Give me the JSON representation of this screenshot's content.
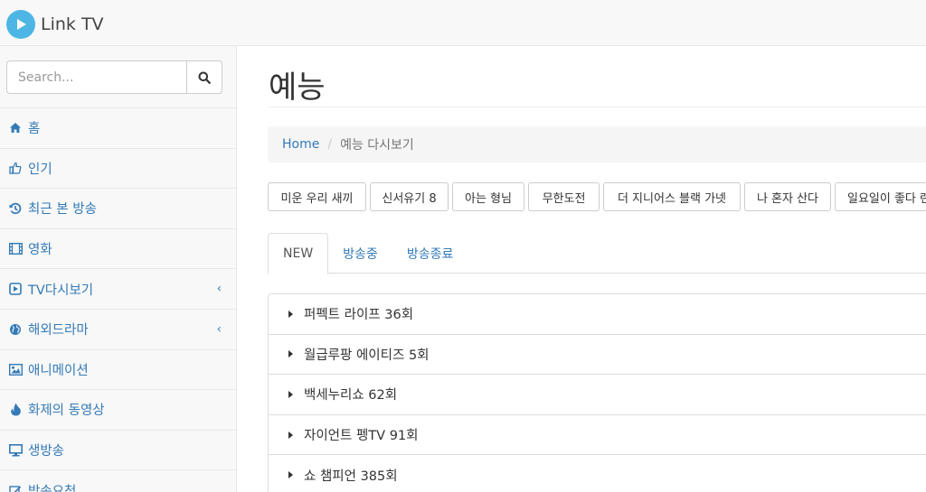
{
  "brand": {
    "title": "Link TV",
    "logo_icon": "play-circle-icon",
    "logo_color": "#4db6e4"
  },
  "search": {
    "placeholder": "Search...",
    "value": ""
  },
  "sidebar": {
    "items": [
      {
        "label": "홈",
        "icon": "home-icon"
      },
      {
        "label": "인기",
        "icon": "thumbs-up-icon"
      },
      {
        "label": "최근 본 방송",
        "icon": "history-icon"
      },
      {
        "label": "영화",
        "icon": "film-icon"
      },
      {
        "label": "TV다시보기",
        "icon": "play-square-icon",
        "chevron": "‹"
      },
      {
        "label": "해외드라마",
        "icon": "globe-icon",
        "chevron": "‹"
      },
      {
        "label": "애니메이션",
        "icon": "image-icon"
      },
      {
        "label": "화제의 동영상",
        "icon": "fire-icon"
      },
      {
        "label": "생방송",
        "icon": "desktop-icon"
      },
      {
        "label": "방송요청",
        "icon": "edit-icon"
      }
    ]
  },
  "main": {
    "title": "예능",
    "breadcrumb": {
      "home": "Home",
      "separator": "/",
      "current": "예능 다시보기"
    },
    "tags": [
      "미운 우리 새끼",
      "신서유기 8",
      "아는 형님",
      "무한도전",
      "더 지니어스 블랙 가넷",
      "나 혼자 산다",
      "일요일이 좋다 런닝맨"
    ],
    "tabs": [
      {
        "label": "NEW",
        "active": true
      },
      {
        "label": "방송중",
        "active": false
      },
      {
        "label": "방송종료",
        "active": false
      }
    ],
    "episodes": [
      "퍼펙트 라이프 36회",
      "월급루팡 에이티즈 5회",
      "백세누리쇼 62회",
      "자이언트 펭TV 91회",
      "쇼 챔피언 385회"
    ]
  },
  "colors": {
    "link": "#337ab7",
    "navbar_bg": "#f8f8f8",
    "border": "#e7e7e7"
  }
}
